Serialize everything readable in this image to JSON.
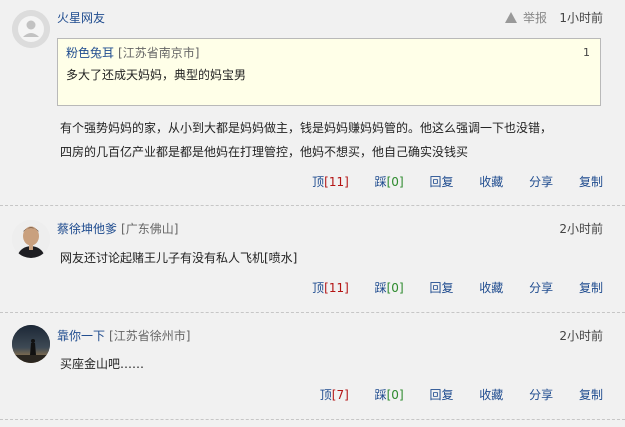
{
  "comments": [
    {
      "username": "火星网友",
      "location": "",
      "report_label": "举报",
      "time": "1小时前",
      "quote": {
        "username": "粉色兔耳",
        "location": "[江苏省南京市]",
        "floor": "1",
        "text": "多大了还成天妈妈，典型的妈宝男"
      },
      "content_lines": [
        "有个强势妈妈的家，从小到大都是妈妈做主，钱是妈妈赚妈妈管的。他这么强调一下也没错，",
        "四房的几百亿产业都是都是他妈在打理管控，他妈不想买，他自己确实没钱买"
      ],
      "actions": {
        "up_label": "顶",
        "up_count": "[11]",
        "down_label": "踩",
        "down_count": "[0]",
        "reply": "回复",
        "favorite": "收藏",
        "share": "分享",
        "copy": "复制"
      }
    },
    {
      "username": "蔡徐坤他爹",
      "location": "[广东佛山]",
      "time": "2小时前",
      "content_lines": [
        "网友还讨论起赌王儿子有没有私人飞机[喷水]"
      ],
      "actions": {
        "up_label": "顶",
        "up_count": "[11]",
        "down_label": "踩",
        "down_count": "[0]",
        "reply": "回复",
        "favorite": "收藏",
        "share": "分享",
        "copy": "复制"
      }
    },
    {
      "username": "靠你一下",
      "location": "[江苏省徐州市]",
      "time": "2小时前",
      "content_lines": [
        "买座金山吧……"
      ],
      "actions": {
        "up_label": "顶",
        "up_count": "[7]",
        "down_label": "踩",
        "down_count": "[0]",
        "reply": "回复",
        "favorite": "收藏",
        "share": "分享",
        "copy": "复制"
      }
    }
  ],
  "colors": {
    "background": "#f1f1f1",
    "link": "#1f4c8f",
    "up_count": "#b41414",
    "down_count": "#2d8a2d",
    "quote_bg": "#ffffe8"
  }
}
